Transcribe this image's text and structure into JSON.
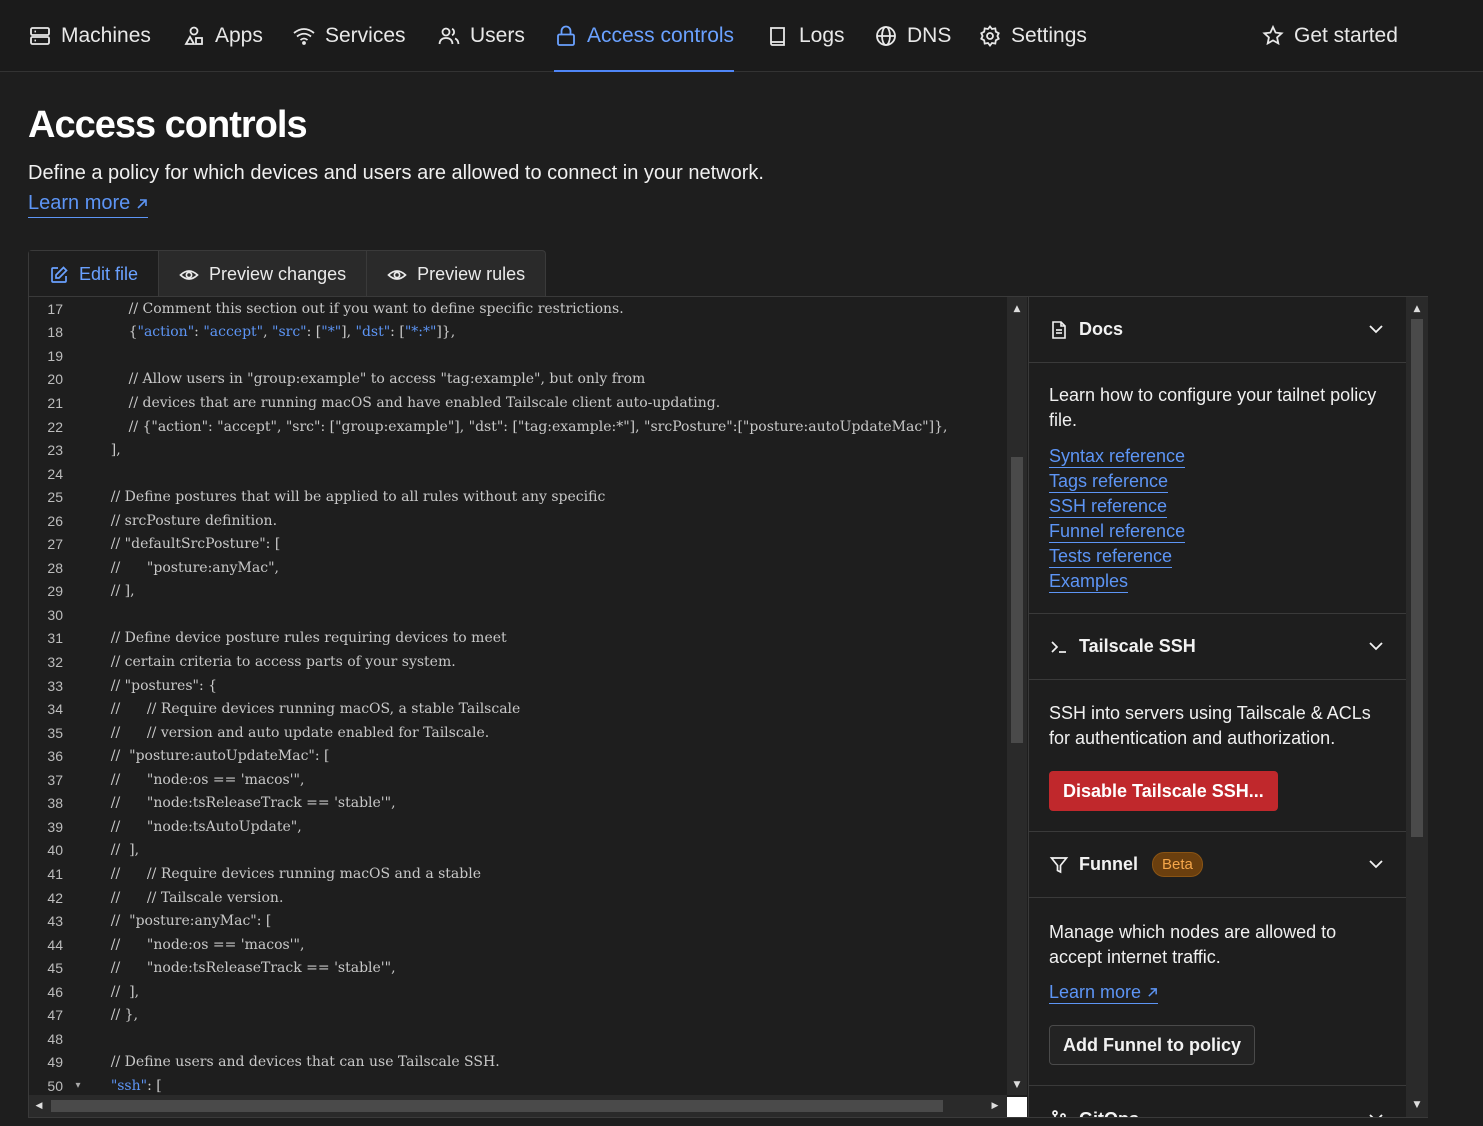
{
  "nav": {
    "items": [
      {
        "label": "Machines",
        "icon": "machines-icon"
      },
      {
        "label": "Apps",
        "icon": "apps-icon"
      },
      {
        "label": "Services",
        "icon": "wifi-icon"
      },
      {
        "label": "Users",
        "icon": "users-icon"
      },
      {
        "label": "Access controls",
        "icon": "lock-icon",
        "active": true
      },
      {
        "label": "Logs",
        "icon": "book-icon"
      },
      {
        "label": "DNS",
        "icon": "globe-icon"
      },
      {
        "label": "Settings",
        "icon": "gear-icon"
      }
    ],
    "get_started": "Get started"
  },
  "page": {
    "title": "Access controls",
    "description": "Define a policy for which devices and users are allowed to connect in your network.",
    "learn_more": "Learn more"
  },
  "tabs": [
    {
      "label": "Edit file",
      "icon": "edit-icon",
      "active": true
    },
    {
      "label": "Preview changes",
      "icon": "eye-icon"
    },
    {
      "label": "Preview rules",
      "icon": "eye-icon"
    }
  ],
  "editor": {
    "lines": [
      {
        "n": "17",
        "text": "        // Comment this section out if you want to define specific restrictions."
      },
      {
        "n": "18",
        "text": "        {\"action\": \"accept\", \"src\": [\"*\"], \"dst\": [\"*:*\"]},"
      },
      {
        "n": "19",
        "text": ""
      },
      {
        "n": "20",
        "text": "        // Allow users in \"group:example\" to access \"tag:example\", but only from"
      },
      {
        "n": "21",
        "text": "        // devices that are running macOS and have enabled Tailscale client auto-updating."
      },
      {
        "n": "22",
        "text": "        // {\"action\": \"accept\", \"src\": [\"group:example\"], \"dst\": [\"tag:example:*\"], \"srcPosture\":[\"posture:autoUpdateMac\"]},"
      },
      {
        "n": "23",
        "text": "    ],"
      },
      {
        "n": "24",
        "text": ""
      },
      {
        "n": "25",
        "text": "    // Define postures that will be applied to all rules without any specific"
      },
      {
        "n": "26",
        "text": "    // srcPosture definition."
      },
      {
        "n": "27",
        "text": "    // \"defaultSrcPosture\": ["
      },
      {
        "n": "28",
        "text": "    //      \"posture:anyMac\","
      },
      {
        "n": "29",
        "text": "    // ],"
      },
      {
        "n": "30",
        "text": ""
      },
      {
        "n": "31",
        "text": "    // Define device posture rules requiring devices to meet"
      },
      {
        "n": "32",
        "text": "    // certain criteria to access parts of your system."
      },
      {
        "n": "33",
        "text": "    // \"postures\": {"
      },
      {
        "n": "34",
        "text": "    //      // Require devices running macOS, a stable Tailscale"
      },
      {
        "n": "35",
        "text": "    //      // version and auto update enabled for Tailscale."
      },
      {
        "n": "36",
        "text": "    //  \"posture:autoUpdateMac\": ["
      },
      {
        "n": "37",
        "text": "    //      \"node:os == 'macos'\","
      },
      {
        "n": "38",
        "text": "    //      \"node:tsReleaseTrack == 'stable'\","
      },
      {
        "n": "39",
        "text": "    //      \"node:tsAutoUpdate\","
      },
      {
        "n": "40",
        "text": "    //  ],"
      },
      {
        "n": "41",
        "text": "    //      // Require devices running macOS and a stable"
      },
      {
        "n": "42",
        "text": "    //      // Tailscale version."
      },
      {
        "n": "43",
        "text": "    //  \"posture:anyMac\": ["
      },
      {
        "n": "44",
        "text": "    //      \"node:os == 'macos'\","
      },
      {
        "n": "45",
        "text": "    //      \"node:tsReleaseTrack == 'stable'\","
      },
      {
        "n": "46",
        "text": "    //  ],"
      },
      {
        "n": "47",
        "text": "    // },"
      },
      {
        "n": "48",
        "text": ""
      },
      {
        "n": "49",
        "text": "    // Define users and devices that can use Tailscale SSH."
      },
      {
        "n": "50",
        "text": "    \"ssh\": [",
        "fold": "▾"
      }
    ]
  },
  "side": {
    "docs": {
      "title": "Docs",
      "body": "Learn how to configure your tailnet policy file.",
      "links": [
        "Syntax reference",
        "Tags reference",
        "SSH reference",
        "Funnel reference",
        "Tests reference",
        "Examples"
      ]
    },
    "ssh": {
      "title": "Tailscale SSH",
      "body": "SSH into servers using Tailscale & ACLs for authentication and authorization.",
      "button": "Disable Tailscale SSH..."
    },
    "funnel": {
      "title": "Funnel",
      "badge": "Beta",
      "body": "Manage which nodes are allowed to accept internet traffic.",
      "learn_more": "Learn more",
      "button": "Add Funnel to policy"
    },
    "gitops": {
      "title": "GitOps"
    }
  },
  "colors": {
    "accent": "#5d95f5",
    "danger": "#c0282c",
    "badge": "#f5a64a"
  }
}
